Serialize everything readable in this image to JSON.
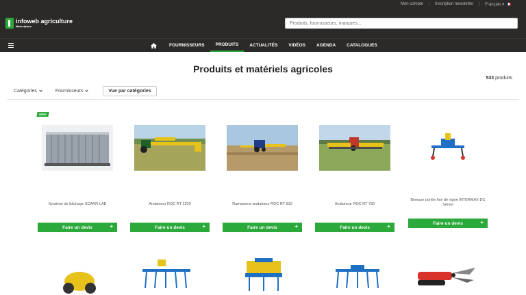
{
  "util": {
    "account": "Mon compte",
    "newsletter": "Inscription newsletter",
    "language": "Français"
  },
  "header": {
    "logo_name": "infoweb agriculture",
    "logo_sub": "Marketplace",
    "search_placeholder": "Produits, fournisseurs, marques..."
  },
  "nav": {
    "items": [
      {
        "label": "FOURNISSEURS",
        "active": false
      },
      {
        "label": "PRODUITS",
        "active": true
      },
      {
        "label": "ACTUALITÉS",
        "active": false
      },
      {
        "label": "VIDÉOS",
        "active": false
      },
      {
        "label": "AGENDA",
        "active": false
      },
      {
        "label": "CATALOGUES",
        "active": false
      }
    ]
  },
  "page": {
    "title": "Produits et matériels agricoles",
    "filter_categories": "Catégories",
    "filter_suppliers": "Fournisseurs",
    "view_button": "Vue par catégories",
    "count_number": "533",
    "count_label": "produits"
  },
  "badge_new": "NEW",
  "products": [
    {
      "name": "Système de bâchage SCARR-LAB",
      "cta": "Faire un devis",
      "icon": "container-photo"
    },
    {
      "name": "Andaineur ROC RT 1220",
      "cta": "Faire un devis",
      "icon": "tractor-field-photo"
    },
    {
      "name": "Ramasseur-andaineur ROC RT 810",
      "cta": "Faire un devis",
      "icon": "tractor-field-photo"
    },
    {
      "name": "Andaineur ROC RT 730",
      "cta": "Faire un devis",
      "icon": "tractor-field-photo"
    },
    {
      "name": "Bineuse portée fixe de vigne INTERMAX-DC Series",
      "cta": "Faire un devis",
      "icon": "hoe-machine"
    }
  ],
  "colors": {
    "header_bg": "#2b2a29",
    "accent": "#2ba93a"
  }
}
